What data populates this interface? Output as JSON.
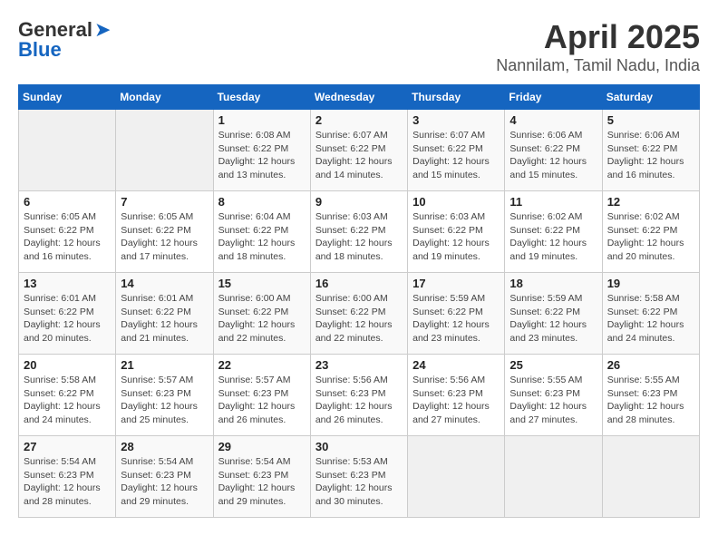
{
  "logo": {
    "line1": "General",
    "line2": "Blue"
  },
  "title": "April 2025",
  "subtitle": "Nannilam, Tamil Nadu, India",
  "days_of_week": [
    "Sunday",
    "Monday",
    "Tuesday",
    "Wednesday",
    "Thursday",
    "Friday",
    "Saturday"
  ],
  "weeks": [
    [
      null,
      null,
      {
        "day": "1",
        "sunrise": "6:08 AM",
        "sunset": "6:22 PM",
        "daylight": "12 hours and 13 minutes."
      },
      {
        "day": "2",
        "sunrise": "6:07 AM",
        "sunset": "6:22 PM",
        "daylight": "12 hours and 14 minutes."
      },
      {
        "day": "3",
        "sunrise": "6:07 AM",
        "sunset": "6:22 PM",
        "daylight": "12 hours and 15 minutes."
      },
      {
        "day": "4",
        "sunrise": "6:06 AM",
        "sunset": "6:22 PM",
        "daylight": "12 hours and 15 minutes."
      },
      {
        "day": "5",
        "sunrise": "6:06 AM",
        "sunset": "6:22 PM",
        "daylight": "12 hours and 16 minutes."
      }
    ],
    [
      {
        "day": "6",
        "sunrise": "6:05 AM",
        "sunset": "6:22 PM",
        "daylight": "12 hours and 16 minutes."
      },
      {
        "day": "7",
        "sunrise": "6:05 AM",
        "sunset": "6:22 PM",
        "daylight": "12 hours and 17 minutes."
      },
      {
        "day": "8",
        "sunrise": "6:04 AM",
        "sunset": "6:22 PM",
        "daylight": "12 hours and 18 minutes."
      },
      {
        "day": "9",
        "sunrise": "6:03 AM",
        "sunset": "6:22 PM",
        "daylight": "12 hours and 18 minutes."
      },
      {
        "day": "10",
        "sunrise": "6:03 AM",
        "sunset": "6:22 PM",
        "daylight": "12 hours and 19 minutes."
      },
      {
        "day": "11",
        "sunrise": "6:02 AM",
        "sunset": "6:22 PM",
        "daylight": "12 hours and 19 minutes."
      },
      {
        "day": "12",
        "sunrise": "6:02 AM",
        "sunset": "6:22 PM",
        "daylight": "12 hours and 20 minutes."
      }
    ],
    [
      {
        "day": "13",
        "sunrise": "6:01 AM",
        "sunset": "6:22 PM",
        "daylight": "12 hours and 20 minutes."
      },
      {
        "day": "14",
        "sunrise": "6:01 AM",
        "sunset": "6:22 PM",
        "daylight": "12 hours and 21 minutes."
      },
      {
        "day": "15",
        "sunrise": "6:00 AM",
        "sunset": "6:22 PM",
        "daylight": "12 hours and 22 minutes."
      },
      {
        "day": "16",
        "sunrise": "6:00 AM",
        "sunset": "6:22 PM",
        "daylight": "12 hours and 22 minutes."
      },
      {
        "day": "17",
        "sunrise": "5:59 AM",
        "sunset": "6:22 PM",
        "daylight": "12 hours and 23 minutes."
      },
      {
        "day": "18",
        "sunrise": "5:59 AM",
        "sunset": "6:22 PM",
        "daylight": "12 hours and 23 minutes."
      },
      {
        "day": "19",
        "sunrise": "5:58 AM",
        "sunset": "6:22 PM",
        "daylight": "12 hours and 24 minutes."
      }
    ],
    [
      {
        "day": "20",
        "sunrise": "5:58 AM",
        "sunset": "6:22 PM",
        "daylight": "12 hours and 24 minutes."
      },
      {
        "day": "21",
        "sunrise": "5:57 AM",
        "sunset": "6:23 PM",
        "daylight": "12 hours and 25 minutes."
      },
      {
        "day": "22",
        "sunrise": "5:57 AM",
        "sunset": "6:23 PM",
        "daylight": "12 hours and 26 minutes."
      },
      {
        "day": "23",
        "sunrise": "5:56 AM",
        "sunset": "6:23 PM",
        "daylight": "12 hours and 26 minutes."
      },
      {
        "day": "24",
        "sunrise": "5:56 AM",
        "sunset": "6:23 PM",
        "daylight": "12 hours and 27 minutes."
      },
      {
        "day": "25",
        "sunrise": "5:55 AM",
        "sunset": "6:23 PM",
        "daylight": "12 hours and 27 minutes."
      },
      {
        "day": "26",
        "sunrise": "5:55 AM",
        "sunset": "6:23 PM",
        "daylight": "12 hours and 28 minutes."
      }
    ],
    [
      {
        "day": "27",
        "sunrise": "5:54 AM",
        "sunset": "6:23 PM",
        "daylight": "12 hours and 28 minutes."
      },
      {
        "day": "28",
        "sunrise": "5:54 AM",
        "sunset": "6:23 PM",
        "daylight": "12 hours and 29 minutes."
      },
      {
        "day": "29",
        "sunrise": "5:54 AM",
        "sunset": "6:23 PM",
        "daylight": "12 hours and 29 minutes."
      },
      {
        "day": "30",
        "sunrise": "5:53 AM",
        "sunset": "6:23 PM",
        "daylight": "12 hours and 30 minutes."
      },
      null,
      null,
      null
    ]
  ],
  "labels": {
    "sunrise": "Sunrise: ",
    "sunset": "Sunset: ",
    "daylight": "Daylight: "
  }
}
